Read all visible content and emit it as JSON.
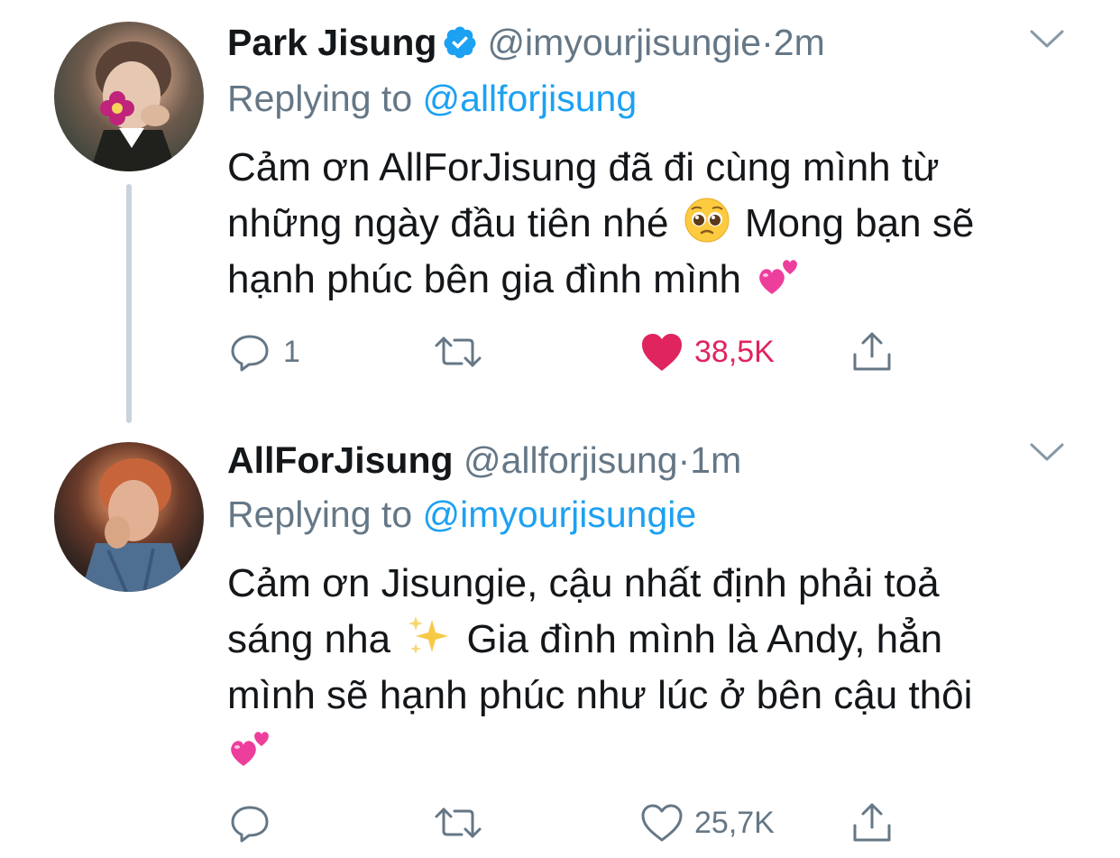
{
  "colors": {
    "accent": "#1da1f2",
    "muted": "#657786",
    "like": "#e0245e",
    "thread_line": "#c9d3dc"
  },
  "tweets": [
    {
      "name": "Park Jisung",
      "verified": true,
      "handle": "@imyourjisungie",
      "dot": "·",
      "time": "2m",
      "replying_prefix": "Replying to ",
      "replying_to": "@allforjisung",
      "text_line1": "Cảm ơn AllForJisung đã đi cùng mình từ",
      "text_line2a": "những ngày đầu tiên nhé",
      "text_line2b": "Mong bạn sẽ",
      "text_line3": "hạnh phúc bên gia đình mình",
      "emojis": [
        "pleading-face",
        "two-hearts"
      ],
      "reply_count": "1",
      "retweet_count": "",
      "like_count": "38,5K",
      "liked": true
    },
    {
      "name": "AllForJisung",
      "verified": false,
      "handle": "@allforjisung",
      "dot": "·",
      "time": "1m",
      "replying_prefix": "Replying to ",
      "replying_to": "@imyourjisungie",
      "text_line1": "Cảm ơn Jisungie, cậu nhất định phải toả",
      "text_line2a": "sáng nha",
      "text_line2b": "Gia đình mình là Andy, hẳn",
      "text_line3": "mình sẽ hạnh phúc như lúc ở bên cậu thôi",
      "emojis": [
        "sparkles",
        "two-hearts"
      ],
      "reply_count": "",
      "retweet_count": "",
      "like_count": "25,7K",
      "liked": false
    }
  ]
}
